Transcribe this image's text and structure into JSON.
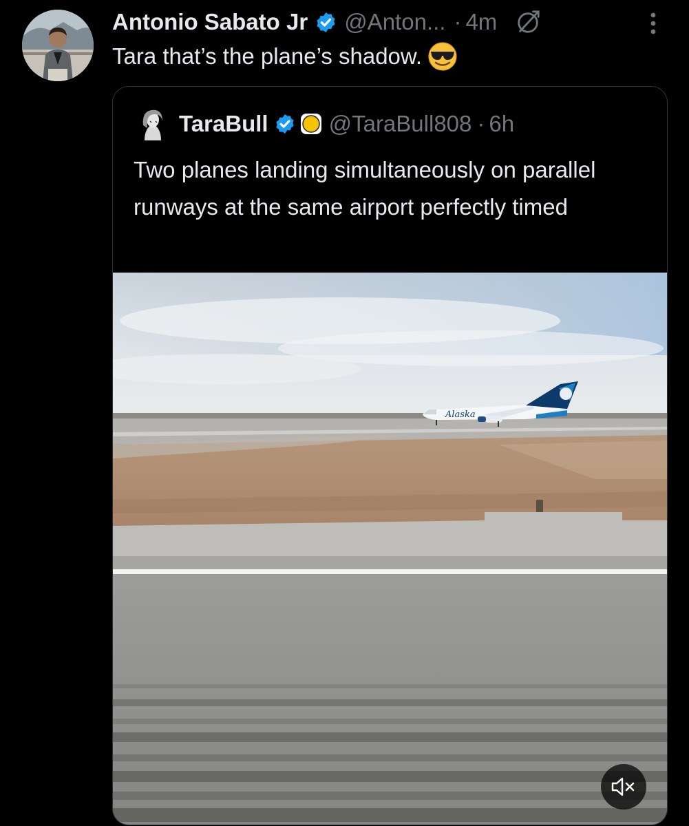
{
  "tweet": {
    "author": {
      "display_name": "Antonio Sabato Jr",
      "handle": "@Anton...",
      "verified": true
    },
    "separator": "·",
    "time": "4m",
    "text": "Tara that’s the plane’s shadow."
  },
  "quoted_tweet": {
    "author": {
      "display_name": "TaraBull",
      "handle": "@TaraBull808",
      "verified": true
    },
    "separator": "·",
    "time": "6h",
    "text": "Two planes landing simultaneously on parallel runways at the same airport perfectly timed",
    "media": {
      "type": "video",
      "muted": true,
      "aircraft_livery_text": "Alaska"
    }
  },
  "icons": {
    "verified": "verified-badge-icon",
    "no_edit": "edit-disabled-icon",
    "more": "more-vertical-icon",
    "emoji": "smiling-face-with-sunglasses",
    "mute": "speaker-muted-icon"
  },
  "colors": {
    "background": "#000000",
    "primary_text": "#e7e9ea",
    "secondary_text": "#71767b",
    "verified_blue": "#1d9bf0",
    "card_border": "#2f3336"
  }
}
